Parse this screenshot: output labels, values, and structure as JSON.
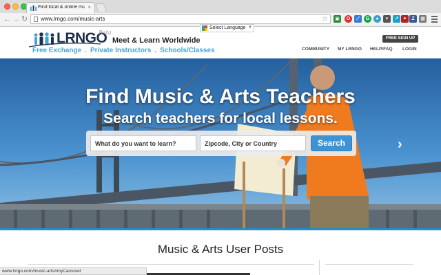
{
  "browser": {
    "tab_title": "Find local & online music & ar",
    "tab_close": "×",
    "url": "www.lrngo.com/music-arts",
    "status_url": "www.lrngo.com/music-arts#myCarousel"
  },
  "header": {
    "logo": "LRNGO",
    "beta": "Beta",
    "tagline": "Meet & Learn Worldwide",
    "links": [
      {
        "label": "Free Exchange"
      },
      {
        "label": "Private Instructors"
      },
      {
        "label": "Schools/Classes"
      }
    ],
    "link_separator": ".",
    "translate_label": "Select Language",
    "translate_arrow": "▼",
    "signup": "FREE SIGN UP",
    "nav": [
      {
        "label": "COMMUNITY"
      },
      {
        "label": "MY LRNGO"
      },
      {
        "label": "HELP/FAQ"
      },
      {
        "label": "LOGIN"
      }
    ]
  },
  "hero": {
    "title": "Find Music & Arts Teachers",
    "subtitle": "Search teachers for local lessons.",
    "search_what_placeholder": "What do you want to learn?",
    "search_where_placeholder": "Zipcode, City or Country",
    "search_button": "Search",
    "next_arrow": "›"
  },
  "posts": {
    "title": "Music & Arts User Posts"
  },
  "icons": {
    "menu": "hamburger-menu-icon",
    "star": "bookmark-star-icon",
    "translate": "google-g-icon",
    "next": "chevron-right-icon"
  },
  "colors": {
    "brand_blue": "#3da7db",
    "logo_navy": "#1d2f4b",
    "search_button": "#3e93d4",
    "signup_button": "#444444"
  }
}
